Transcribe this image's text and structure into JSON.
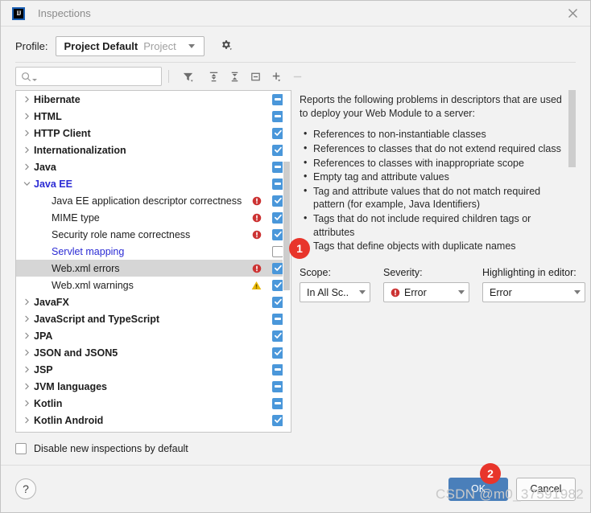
{
  "window": {
    "title": "Inspections",
    "app_icon": "intellij-idea-logo",
    "close_icon": "close-icon"
  },
  "profile": {
    "label": "Profile:",
    "selected_name": "Project Default",
    "selected_scope": "Project",
    "gear_icon": "gear-icon"
  },
  "toolbar": {
    "search_value": "",
    "search_placeholder": "",
    "search_icon": "search-icon",
    "buttons": [
      {
        "name": "filter-button",
        "icon": "filter-funnel-icon",
        "disabled": false
      },
      {
        "name": "expand-all-button",
        "icon": "expand-all-icon",
        "disabled": false
      },
      {
        "name": "collapse-all-button",
        "icon": "collapse-all-icon",
        "disabled": false
      },
      {
        "name": "group-by-button",
        "icon": "square-minus-icon",
        "disabled": false
      },
      {
        "name": "add-button",
        "icon": "plus-icon",
        "disabled": false
      },
      {
        "name": "remove-button",
        "icon": "minus-icon",
        "disabled": true
      }
    ]
  },
  "tree": {
    "rows": [
      {
        "label": "Hibernate",
        "level": 0,
        "expanded": false,
        "group": true,
        "blue": false,
        "severity": "",
        "check": "partial"
      },
      {
        "label": "HTML",
        "level": 0,
        "expanded": false,
        "group": true,
        "blue": false,
        "severity": "",
        "check": "partial"
      },
      {
        "label": "HTTP Client",
        "level": 0,
        "expanded": false,
        "group": true,
        "blue": false,
        "severity": "",
        "check": "checked"
      },
      {
        "label": "Internationalization",
        "level": 0,
        "expanded": false,
        "group": true,
        "blue": false,
        "severity": "",
        "check": "checked"
      },
      {
        "label": "Java",
        "level": 0,
        "expanded": false,
        "group": true,
        "blue": false,
        "severity": "",
        "check": "partial"
      },
      {
        "label": "Java EE",
        "level": 0,
        "expanded": true,
        "group": true,
        "blue": true,
        "severity": "",
        "check": "partial"
      },
      {
        "label": "Java EE application descriptor correctness",
        "level": 1,
        "expanded": null,
        "group": false,
        "blue": false,
        "severity": "error",
        "check": "checked"
      },
      {
        "label": "MIME type",
        "level": 1,
        "expanded": null,
        "group": false,
        "blue": false,
        "severity": "error",
        "check": "checked"
      },
      {
        "label": "Security role name correctness",
        "level": 1,
        "expanded": null,
        "group": false,
        "blue": false,
        "severity": "error",
        "check": "checked"
      },
      {
        "label": "Servlet mapping",
        "level": 1,
        "expanded": null,
        "group": false,
        "blue": true,
        "severity": "",
        "check": "empty"
      },
      {
        "label": "Web.xml errors",
        "level": 1,
        "expanded": null,
        "group": false,
        "blue": false,
        "severity": "error",
        "check": "checked",
        "selected": true
      },
      {
        "label": "Web.xml warnings",
        "level": 1,
        "expanded": null,
        "group": false,
        "blue": false,
        "severity": "warning",
        "check": "checked"
      },
      {
        "label": "JavaFX",
        "level": 0,
        "expanded": false,
        "group": true,
        "blue": false,
        "severity": "",
        "check": "checked"
      },
      {
        "label": "JavaScript and TypeScript",
        "level": 0,
        "expanded": false,
        "group": true,
        "blue": false,
        "severity": "",
        "check": "partial"
      },
      {
        "label": "JPA",
        "level": 0,
        "expanded": false,
        "group": true,
        "blue": false,
        "severity": "",
        "check": "checked"
      },
      {
        "label": "JSON and JSON5",
        "level": 0,
        "expanded": false,
        "group": true,
        "blue": false,
        "severity": "",
        "check": "checked"
      },
      {
        "label": "JSP",
        "level": 0,
        "expanded": false,
        "group": true,
        "blue": false,
        "severity": "",
        "check": "partial"
      },
      {
        "label": "JVM languages",
        "level": 0,
        "expanded": false,
        "group": true,
        "blue": false,
        "severity": "",
        "check": "partial"
      },
      {
        "label": "Kotlin",
        "level": 0,
        "expanded": false,
        "group": true,
        "blue": false,
        "severity": "",
        "check": "partial"
      },
      {
        "label": "Kotlin Android",
        "level": 0,
        "expanded": false,
        "group": true,
        "blue": false,
        "severity": "",
        "check": "checked"
      }
    ]
  },
  "description": {
    "intro": "Reports the following problems in descriptors that are used to deploy your Web Module to a server:",
    "bullets": [
      "References to non-instantiable classes",
      "References to classes that do not extend required class",
      "References to classes with inappropriate scope",
      "Empty tag and attribute values",
      "Tag and attribute values that do not match required pattern (for example, Java Identifiers)",
      "Tags that do not include required children tags or attributes",
      "Tags that define objects with duplicate names"
    ]
  },
  "options": {
    "scope": {
      "label": "Scope:",
      "value": "In All Sc.."
    },
    "severity": {
      "label": "Severity:",
      "value": "Error",
      "icon": "error-icon"
    },
    "highlighting": {
      "label": "Highlighting in editor:",
      "value": "Error"
    }
  },
  "footer": {
    "disable_new_label": "Disable new inspections by default",
    "disable_new_checked": false,
    "help_label": "?",
    "ok_label": "OK",
    "cancel_label": "Cancel"
  },
  "annotations": {
    "badge1": "1",
    "badge2": "2"
  },
  "watermark": "CSDN @m0_37591982",
  "colors": {
    "checkbox_blue": "#4a97da",
    "ok_button_blue": "#4a7fba",
    "error_red": "#cc3333",
    "warning_yellow": "#e8b800",
    "link_blue": "#2b2bd4",
    "badge_red": "#e8352b"
  }
}
